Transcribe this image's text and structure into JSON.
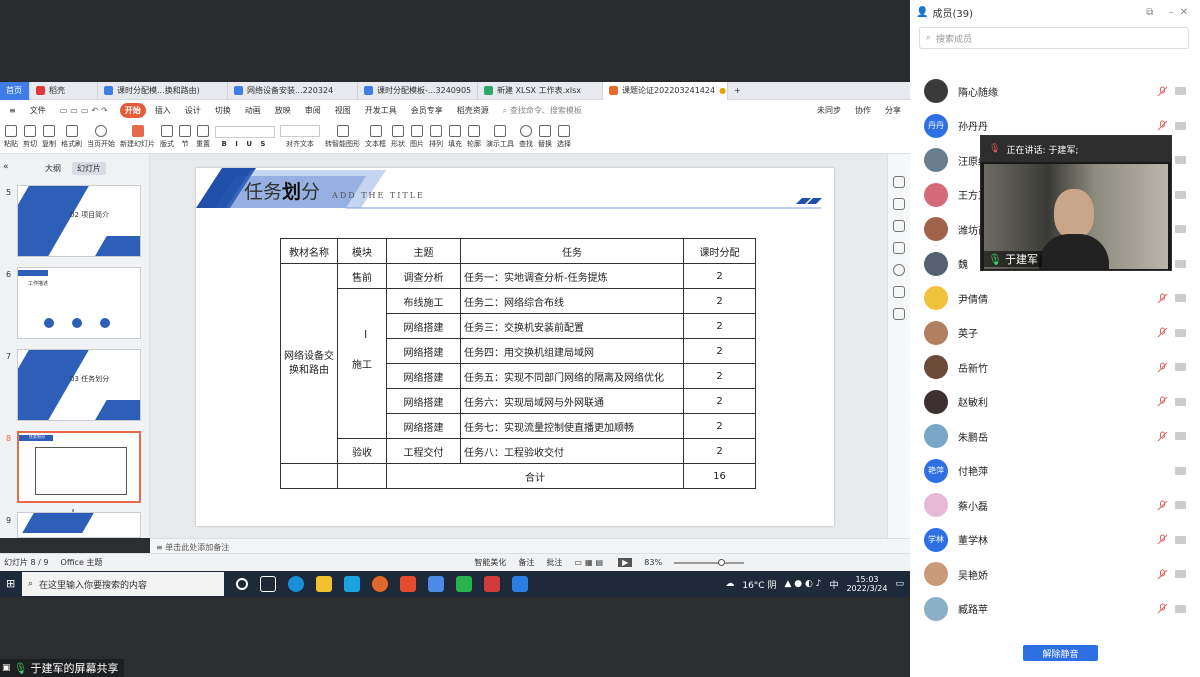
{
  "tabs": [
    {
      "label": "首页",
      "color": "#3e7ce6"
    },
    {
      "label": "稻壳",
      "color": "#e03b3b"
    },
    {
      "label": "课时分配模...换和路由)",
      "color": "#3e7ce6"
    },
    {
      "label": "网络设备安装...220324",
      "color": "#3e7ce6"
    },
    {
      "label": "课时分配模板-...3240905",
      "color": "#3e7ce6"
    },
    {
      "label": "新建 XLSX 工作表.xlsx",
      "color": "#2ea868"
    },
    {
      "label": "课题论证202203241424",
      "color": "#e86a2a"
    }
  ],
  "menu": {
    "file": "文件",
    "items": [
      "开始",
      "插入",
      "设计",
      "切换",
      "动画",
      "放映",
      "审阅",
      "视图",
      "开发工具",
      "会员专享",
      "稻壳资源"
    ],
    "search": "查找命令、搜索模板",
    "sync": "未同步",
    "collab": "协作",
    "share": "分享"
  },
  "ribbon": [
    "粘贴",
    "剪切",
    "复制",
    "格式刷",
    "当页开始",
    "新建幻灯片",
    "版式",
    "节",
    "重置",
    "文本框",
    "形状",
    "排列",
    "轮廓",
    "演示工具",
    "替换",
    "选择",
    "查找",
    "图片",
    "填充",
    "对齐文本",
    "转智能图形"
  ],
  "panel": {
    "tab_outline": "大纲",
    "tab_slides": "幻灯片"
  },
  "thumbs": [
    {
      "num": "5",
      "text": "02 项目简介"
    },
    {
      "num": "6",
      "text": "工作描述"
    },
    {
      "num": "7",
      "text": "03 任务划分"
    },
    {
      "num": "8",
      "text": "任务划分"
    },
    {
      "num": "9",
      "text": ""
    }
  ],
  "slide": {
    "title_main": "任务",
    "title_bold": "划",
    "title_end": "分",
    "subtitle": "ADD THE TITLE",
    "headers": [
      "教材名称",
      "模块",
      "主题",
      "任务",
      "课时分配"
    ],
    "course": "网络设备交换和路由",
    "modules": [
      "售前",
      "施工",
      "验收"
    ],
    "rows": [
      {
        "topic": "调查分析",
        "task": "任务一：实地调查分析-任务提炼",
        "hours": "2"
      },
      {
        "topic": "布线施工",
        "task": "任务二：网络综合布线",
        "hours": "2"
      },
      {
        "topic": "网络搭建",
        "task": "任务三：交换机安装前配置",
        "hours": "2"
      },
      {
        "topic": "网络搭建",
        "task": "任务四：用交换机组建局域网",
        "hours": "2"
      },
      {
        "topic": "网络搭建",
        "task": "任务五：实现不同部门网络的隔离及网络优化",
        "hours": "2"
      },
      {
        "topic": "网络搭建",
        "task": "任务六：实现局域网与外网联通",
        "hours": "2"
      },
      {
        "topic": "网络搭建",
        "task": "任务七：实现流量控制使直播更加顺畅",
        "hours": "2"
      },
      {
        "topic": "工程交付",
        "task": "任务八：工程验收交付",
        "hours": "2"
      }
    ],
    "total_label": "合计",
    "total_value": "16"
  },
  "notes": "单击此处添加备注",
  "status": {
    "slide": "幻灯片 8 / 9",
    "theme": "Office 主题",
    "beautify": "智能美化",
    "notes_btn": "备注",
    "comment": "批注",
    "zoom": "83%"
  },
  "taskbar": {
    "search": "在这里输入你要搜索的内容",
    "temp": "16°C 阴",
    "ime": "中",
    "time": "15:03",
    "date": "2022/3/24"
  },
  "share_label": "于建军的屏幕共享",
  "members_panel": {
    "title": "成员(39)",
    "search": "搜索成员",
    "speaking": "正在讲话: 于建军;",
    "video_name": "于建军",
    "unmute": "解除静音",
    "list": [
      {
        "name": "隋心随缘",
        "color": "#3a3a3a",
        "initials": ""
      },
      {
        "name": "孙丹丹",
        "color": "#2f6fe4",
        "initials": "丹丹"
      },
      {
        "name": "汪原红",
        "color": "#6a7f8e",
        "initials": ""
      },
      {
        "name": "王方正",
        "color": "#d56a7a",
        "initials": ""
      },
      {
        "name": "潍坊商",
        "color": "#a0624b",
        "initials": ""
      },
      {
        "name": "魏",
        "color": "#556070",
        "initials": ""
      },
      {
        "name": "尹倩倩",
        "color": "#f0c23c",
        "initials": ""
      },
      {
        "name": "英子",
        "color": "#b08060",
        "initials": ""
      },
      {
        "name": "岳新竹",
        "color": "#6b4a3a",
        "initials": ""
      },
      {
        "name": "赵敏利",
        "color": "#3c3030",
        "initials": ""
      },
      {
        "name": "朱鹏岳",
        "color": "#7aa7c7",
        "initials": ""
      },
      {
        "name": "付艳萍",
        "color": "#2f6fe4",
        "initials": "艳萍"
      },
      {
        "name": "蔡小磊",
        "color": "#e6b8d6",
        "initials": ""
      },
      {
        "name": "董学林",
        "color": "#2f6fe4",
        "initials": "学林"
      },
      {
        "name": "吴艳娇",
        "color": "#c89a78",
        "initials": ""
      },
      {
        "name": "臧路苹",
        "color": "#8ab0c8",
        "initials": ""
      }
    ]
  }
}
